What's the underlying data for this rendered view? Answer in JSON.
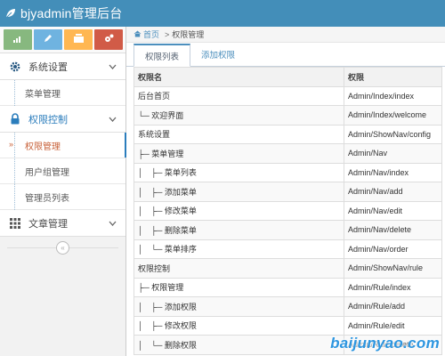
{
  "app": {
    "title": "bjyadmin管理后台"
  },
  "sidebar": {
    "toolbar": [
      {
        "icon": "signal-icon",
        "color": "#87b87f"
      },
      {
        "icon": "pencil-icon",
        "color": "#6fb3e0"
      },
      {
        "icon": "group-icon",
        "color": "#ffb752"
      },
      {
        "icon": "cogs-icon",
        "color": "#d15b47"
      }
    ],
    "groups": [
      {
        "label": "系统设置",
        "icon": "gear-icon",
        "items": [
          {
            "label": "菜单管理"
          }
        ]
      },
      {
        "label": "权限控制",
        "icon": "lock-icon",
        "items": [
          {
            "label": "权限管理",
            "active": true
          },
          {
            "label": "用户组管理"
          },
          {
            "label": "管理员列表"
          }
        ]
      },
      {
        "label": "文章管理",
        "icon": "grid-icon",
        "items": []
      }
    ],
    "collapse_glyph": "«"
  },
  "breadcrumb": {
    "home": "首页",
    "separator": ">",
    "current": "权限管理"
  },
  "tabs": [
    {
      "label": "权限列表",
      "active": true
    },
    {
      "label": "添加权限"
    }
  ],
  "table": {
    "headers": [
      "权限名",
      "权限"
    ],
    "rows": [
      {
        "name": "后台首页",
        "rule": "Admin/Index/index"
      },
      {
        "name": "└─ 欢迎界面",
        "rule": "Admin/Index/welcome"
      },
      {
        "name": "系统设置",
        "rule": "Admin/ShowNav/config"
      },
      {
        "name": "├─ 菜单管理",
        "rule": "Admin/Nav"
      },
      {
        "name": "│　├─ 菜单列表",
        "rule": "Admin/Nav/index"
      },
      {
        "name": "│　├─ 添加菜单",
        "rule": "Admin/Nav/add"
      },
      {
        "name": "│　├─ 修改菜单",
        "rule": "Admin/Nav/edit"
      },
      {
        "name": "│　├─ 删除菜单",
        "rule": "Admin/Nav/delete"
      },
      {
        "name": "│　└─ 菜单排序",
        "rule": "Admin/Nav/order"
      },
      {
        "name": "权限控制",
        "rule": "Admin/ShowNav/rule"
      },
      {
        "name": "├─ 权限管理",
        "rule": "Admin/Rule/index"
      },
      {
        "name": "│　├─ 添加权限",
        "rule": "Admin/Rule/add"
      },
      {
        "name": "│　├─ 修改权限",
        "rule": "Admin/Rule/edit"
      },
      {
        "name": "│　└─ 删除权限",
        "rule": "Admin/Rule/delete"
      }
    ]
  },
  "watermark": "baijunyao.com"
}
